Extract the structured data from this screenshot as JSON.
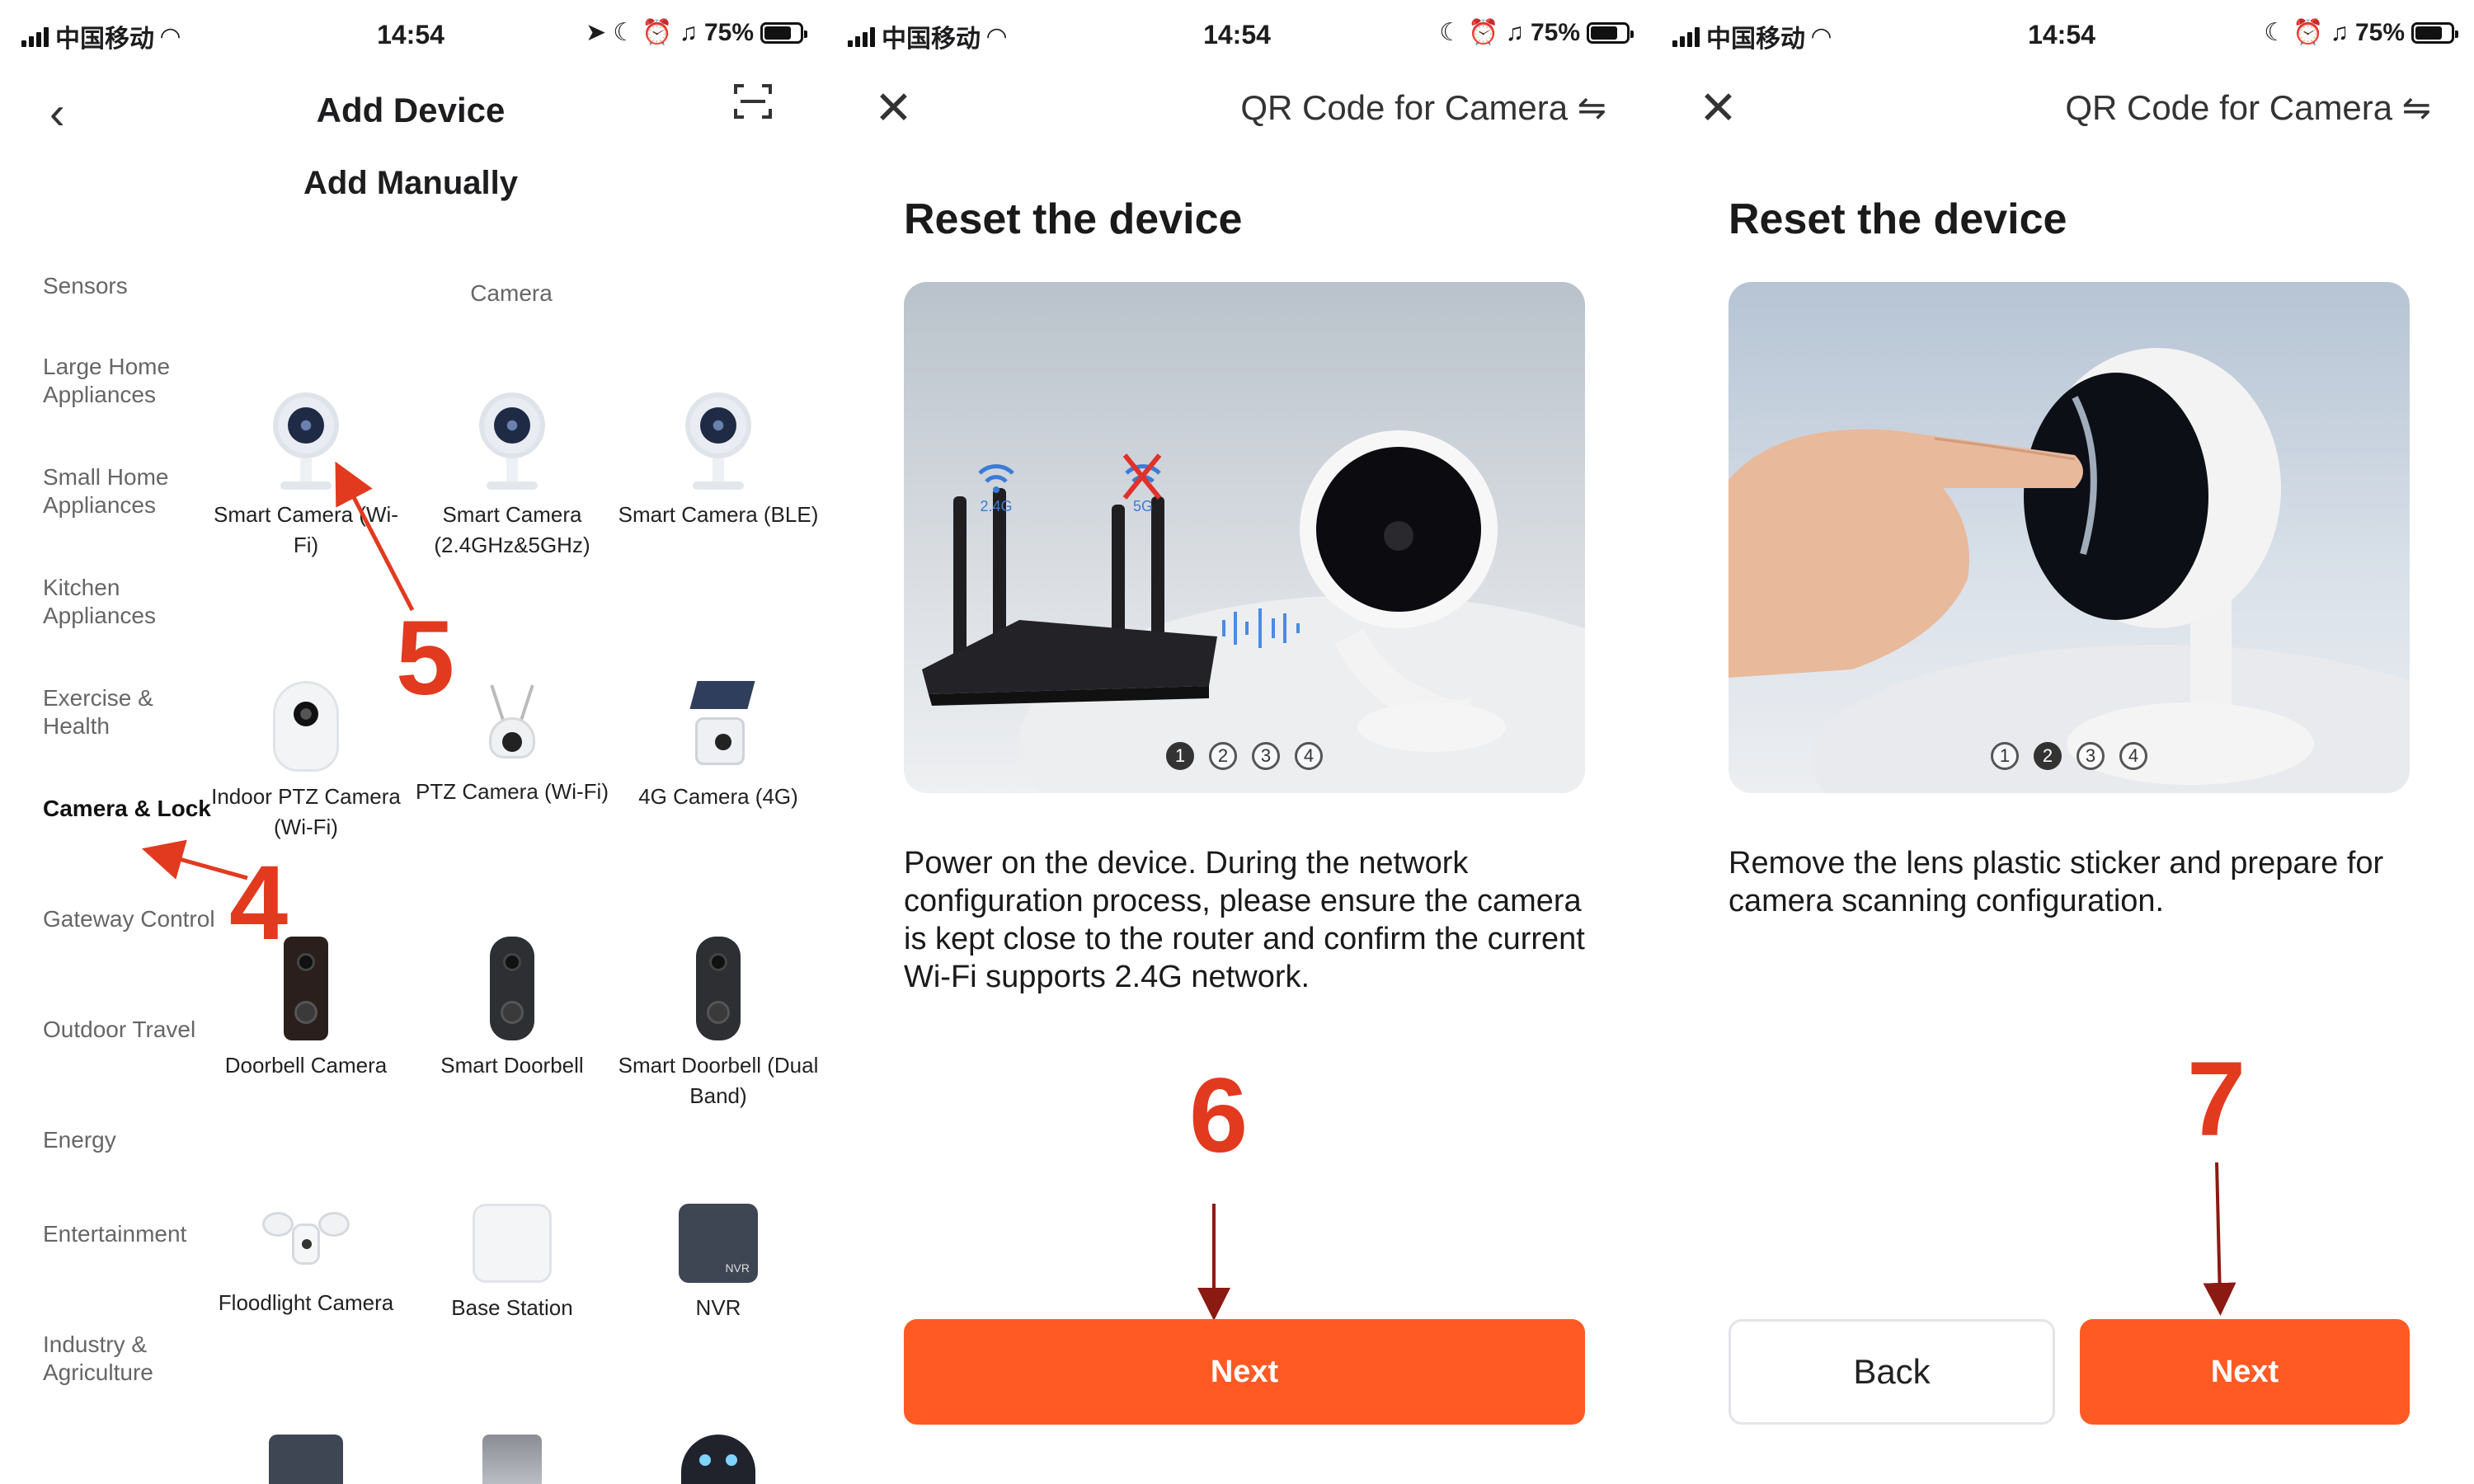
{
  "status_bar": {
    "carrier": "中国移动",
    "time": "14:54",
    "battery": "75%",
    "battery_level": 0.75
  },
  "panel1": {
    "nav_title": "Add Device",
    "subtitle": "Add Manually",
    "sidebar": [
      "Sensors",
      "Large Home Appliances",
      "Small Home Appliances",
      "Kitchen Appliances",
      "Exercise & Health",
      "Camera & Lock",
      "Gateway Control",
      "Outdoor Travel",
      "Energy",
      "Entertainment",
      "Industry & Agriculture"
    ],
    "active_category": "Camera & Lock",
    "section_title": "Camera",
    "devices": [
      "Smart Camera (Wi-Fi)",
      "Smart Camera (2.4GHz&5GHz)",
      "Smart Camera (BLE)",
      "Indoor PTZ Camera (Wi-Fi)",
      "PTZ Camera (Wi-Fi)",
      "4G Camera (4G)",
      "Doorbell Camera",
      "Smart Doorbell",
      "Smart Doorbell (Dual Band)",
      "Floodlight Camera",
      "Base Station",
      "NVR"
    ],
    "nvr_badge": "NVR",
    "annotations": {
      "step4": "4",
      "step5": "5"
    }
  },
  "panel2": {
    "nav_title": "QR Code for Camera ⇋",
    "heading": "Reset the device",
    "wifi_24": "2.4G",
    "wifi_5": "5G",
    "pager": [
      "1",
      "2",
      "3",
      "4"
    ],
    "active_page": 1,
    "description": "Power on the device. During the network configuration process, please ensure the camera is kept close to the router and confirm the current Wi-Fi supports 2.4G network.",
    "next_label": "Next",
    "annotation": "6"
  },
  "panel3": {
    "nav_title": "QR Code for Camera ⇋",
    "heading": "Reset the device",
    "pager": [
      "1",
      "2",
      "3",
      "4"
    ],
    "active_page": 2,
    "description": "Remove the lens plastic sticker and prepare for camera scanning configuration.",
    "back_label": "Back",
    "next_label": "Next",
    "annotation": "7"
  },
  "colors": {
    "accent": "#ff5a23",
    "annotation": "#e23a1f"
  }
}
